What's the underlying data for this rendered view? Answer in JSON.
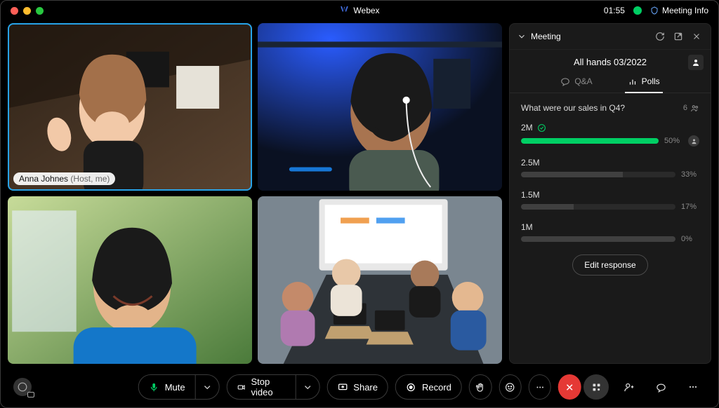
{
  "app": {
    "name": "Webex"
  },
  "header": {
    "clock": "01:55",
    "meetingInfo": "Meeting Info"
  },
  "participants": [
    {
      "name": "Anna Johnes",
      "role": "(Host, me)",
      "active": true
    },
    {
      "name": "",
      "role": ""
    },
    {
      "name": "",
      "role": ""
    },
    {
      "name": "",
      "role": ""
    }
  ],
  "sidepanel": {
    "title": "Meeting",
    "meetingName": "All hands 03/2022",
    "tabs": {
      "qa": "Q&A",
      "polls": "Polls"
    },
    "poll": {
      "question": "What were our sales in Q4?",
      "responders": "6",
      "options": [
        {
          "label": "2M",
          "pct": 50,
          "pctLabel": "50%",
          "selected": true
        },
        {
          "label": "2.5M",
          "pct": 33,
          "pctLabel": "33%",
          "selected": false
        },
        {
          "label": "1.5M",
          "pct": 17,
          "pctLabel": "17%",
          "selected": false
        },
        {
          "label": "1M",
          "pct": 0,
          "pctLabel": "0%",
          "selected": false
        }
      ],
      "editLabel": "Edit response"
    }
  },
  "controls": {
    "mute": "Mute",
    "stopVideo": "Stop video",
    "share": "Share",
    "record": "Record"
  }
}
